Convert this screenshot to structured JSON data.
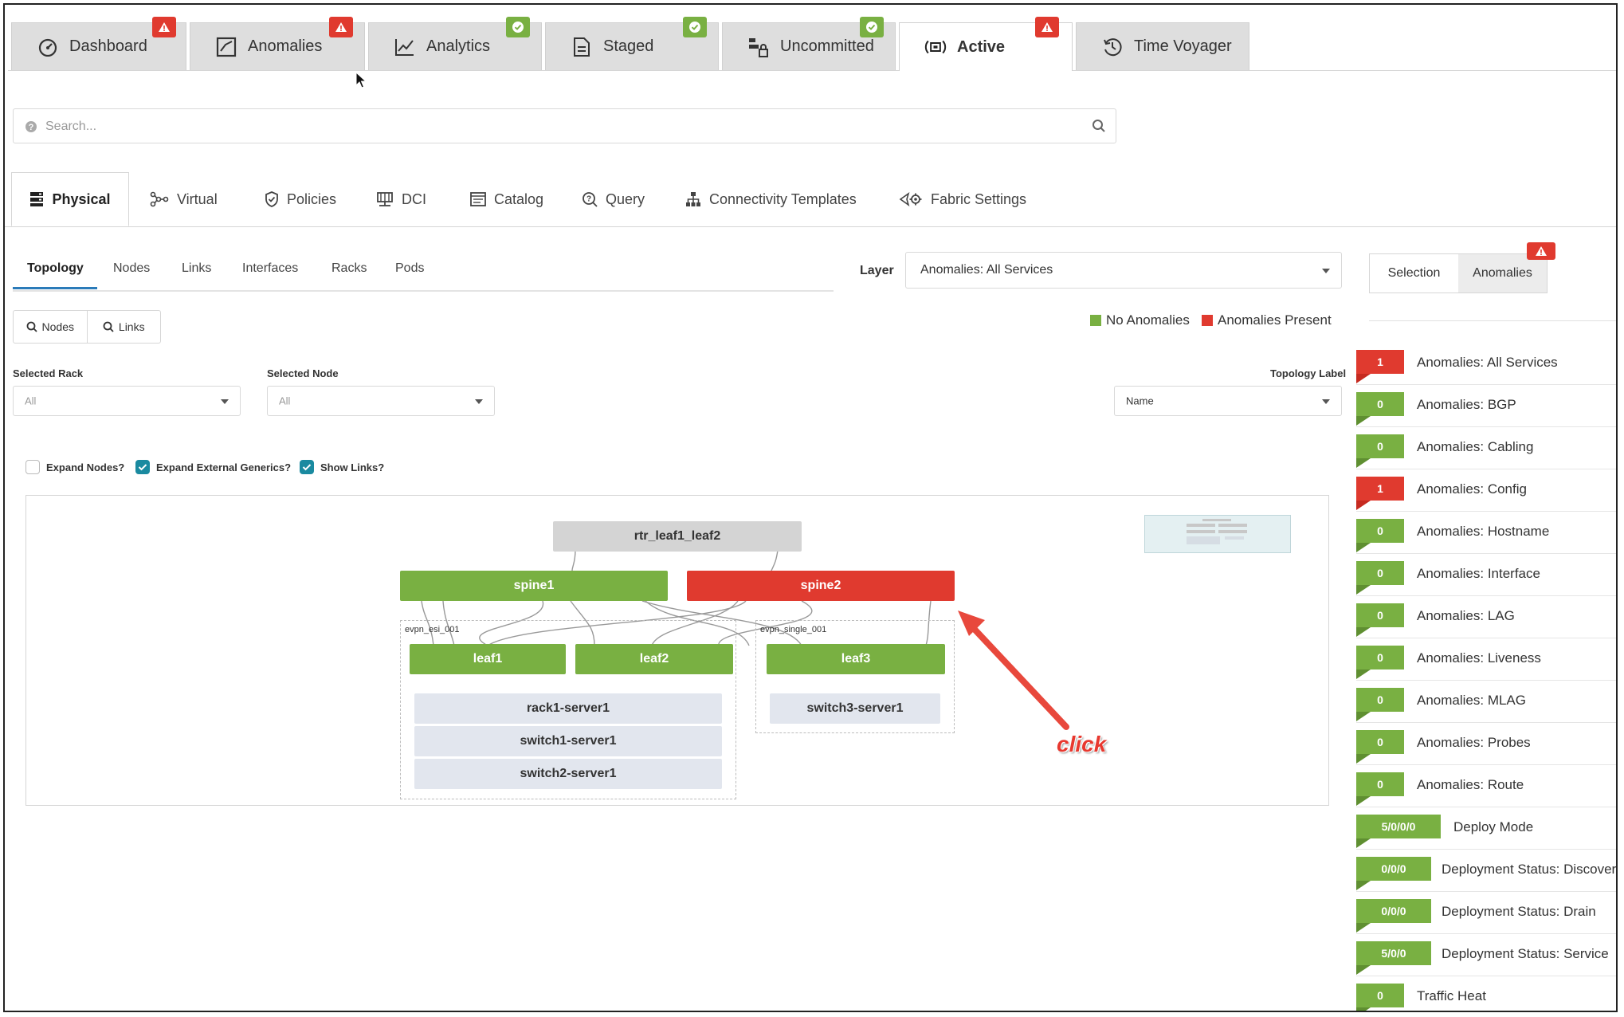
{
  "top_tabs": [
    {
      "label": "Dashboard",
      "icon": "gauge-icon",
      "badge": "red"
    },
    {
      "label": "Anomalies",
      "icon": "anomaly-icon",
      "badge": "red"
    },
    {
      "label": "Analytics",
      "icon": "chart-line-icon",
      "badge": "green"
    },
    {
      "label": "Staged",
      "icon": "document-icon",
      "badge": "green"
    },
    {
      "label": "Uncommitted",
      "icon": "uncommitted-icon",
      "badge": "green"
    },
    {
      "label": "Active",
      "icon": "broadcast-icon",
      "badge": "red"
    },
    {
      "label": "Time Voyager",
      "icon": "history-icon",
      "badge": ""
    }
  ],
  "search": {
    "placeholder": "Search..."
  },
  "sub_tabs": [
    {
      "label": "Physical",
      "icon": "server-rack-icon"
    },
    {
      "label": "Virtual",
      "icon": "network-icon"
    },
    {
      "label": "Policies",
      "icon": "shield-icon"
    },
    {
      "label": "DCI",
      "icon": "dci-icon"
    },
    {
      "label": "Catalog",
      "icon": "catalog-icon"
    },
    {
      "label": "Query",
      "icon": "query-icon"
    },
    {
      "label": "Connectivity Templates",
      "icon": "hierarchy-icon"
    },
    {
      "label": "Fabric Settings",
      "icon": "fabric-settings-icon"
    }
  ],
  "view_tabs": [
    "Topology",
    "Nodes",
    "Links",
    "Interfaces",
    "Racks",
    "Pods"
  ],
  "layer": {
    "label": "Layer",
    "value": "Anomalies: All Services"
  },
  "panel_tabs": {
    "selection": "Selection",
    "anomalies": "Anomalies"
  },
  "search_buttons": {
    "nodes": "Nodes",
    "links": "Links"
  },
  "legend": {
    "no_anomalies": "No Anomalies",
    "anomalies_present": "Anomalies Present"
  },
  "filters": {
    "selected_rack_label": "Selected Rack",
    "selected_rack_value": "All",
    "selected_node_label": "Selected Node",
    "selected_node_value": "All",
    "topology_label_label": "Topology Label",
    "topology_label_value": "Name"
  },
  "checkboxes": {
    "expand_nodes": "Expand Nodes?",
    "expand_external": "Expand External Generics?",
    "show_links": "Show Links?"
  },
  "topology": {
    "external": "rtr_leaf1_leaf2",
    "spine1": "spine1",
    "spine2": "spine2",
    "group1": "evpn_esi_001",
    "group2": "evpn_single_001",
    "leaf1": "leaf1",
    "leaf2": "leaf2",
    "leaf3": "leaf3",
    "servers1": [
      "rack1-server1",
      "switch1-server1",
      "switch2-server1"
    ],
    "servers2": [
      "switch3-server1"
    ]
  },
  "annotation": "click",
  "anomalies": [
    {
      "count": "1",
      "status": "red",
      "label": "Anomalies: All Services"
    },
    {
      "count": "0",
      "status": "green",
      "label": "Anomalies: BGP"
    },
    {
      "count": "0",
      "status": "green",
      "label": "Anomalies: Cabling"
    },
    {
      "count": "1",
      "status": "red",
      "label": "Anomalies: Config"
    },
    {
      "count": "0",
      "status": "green",
      "label": "Anomalies: Hostname"
    },
    {
      "count": "0",
      "status": "green",
      "label": "Anomalies: Interface"
    },
    {
      "count": "0",
      "status": "green",
      "label": "Anomalies: LAG"
    },
    {
      "count": "0",
      "status": "green",
      "label": "Anomalies: Liveness"
    },
    {
      "count": "0",
      "status": "green",
      "label": "Anomalies: MLAG"
    },
    {
      "count": "0",
      "status": "green",
      "label": "Anomalies: Probes"
    },
    {
      "count": "0",
      "status": "green",
      "label": "Anomalies: Route"
    },
    {
      "count": "5/0/0/0",
      "status": "green",
      "label": "Deploy Mode"
    },
    {
      "count": "0/0/0",
      "status": "green",
      "label": "Deployment Status: Discovery"
    },
    {
      "count": "0/0/0",
      "status": "green",
      "label": "Deployment Status: Drain"
    },
    {
      "count": "5/0/0",
      "status": "green",
      "label": "Deployment Status: Service"
    },
    {
      "count": "0",
      "status": "green",
      "label": "Traffic Heat"
    }
  ],
  "colors": {
    "ok": "#79b042",
    "alert": "#e03a2f",
    "accent": "#2b7bb9"
  }
}
